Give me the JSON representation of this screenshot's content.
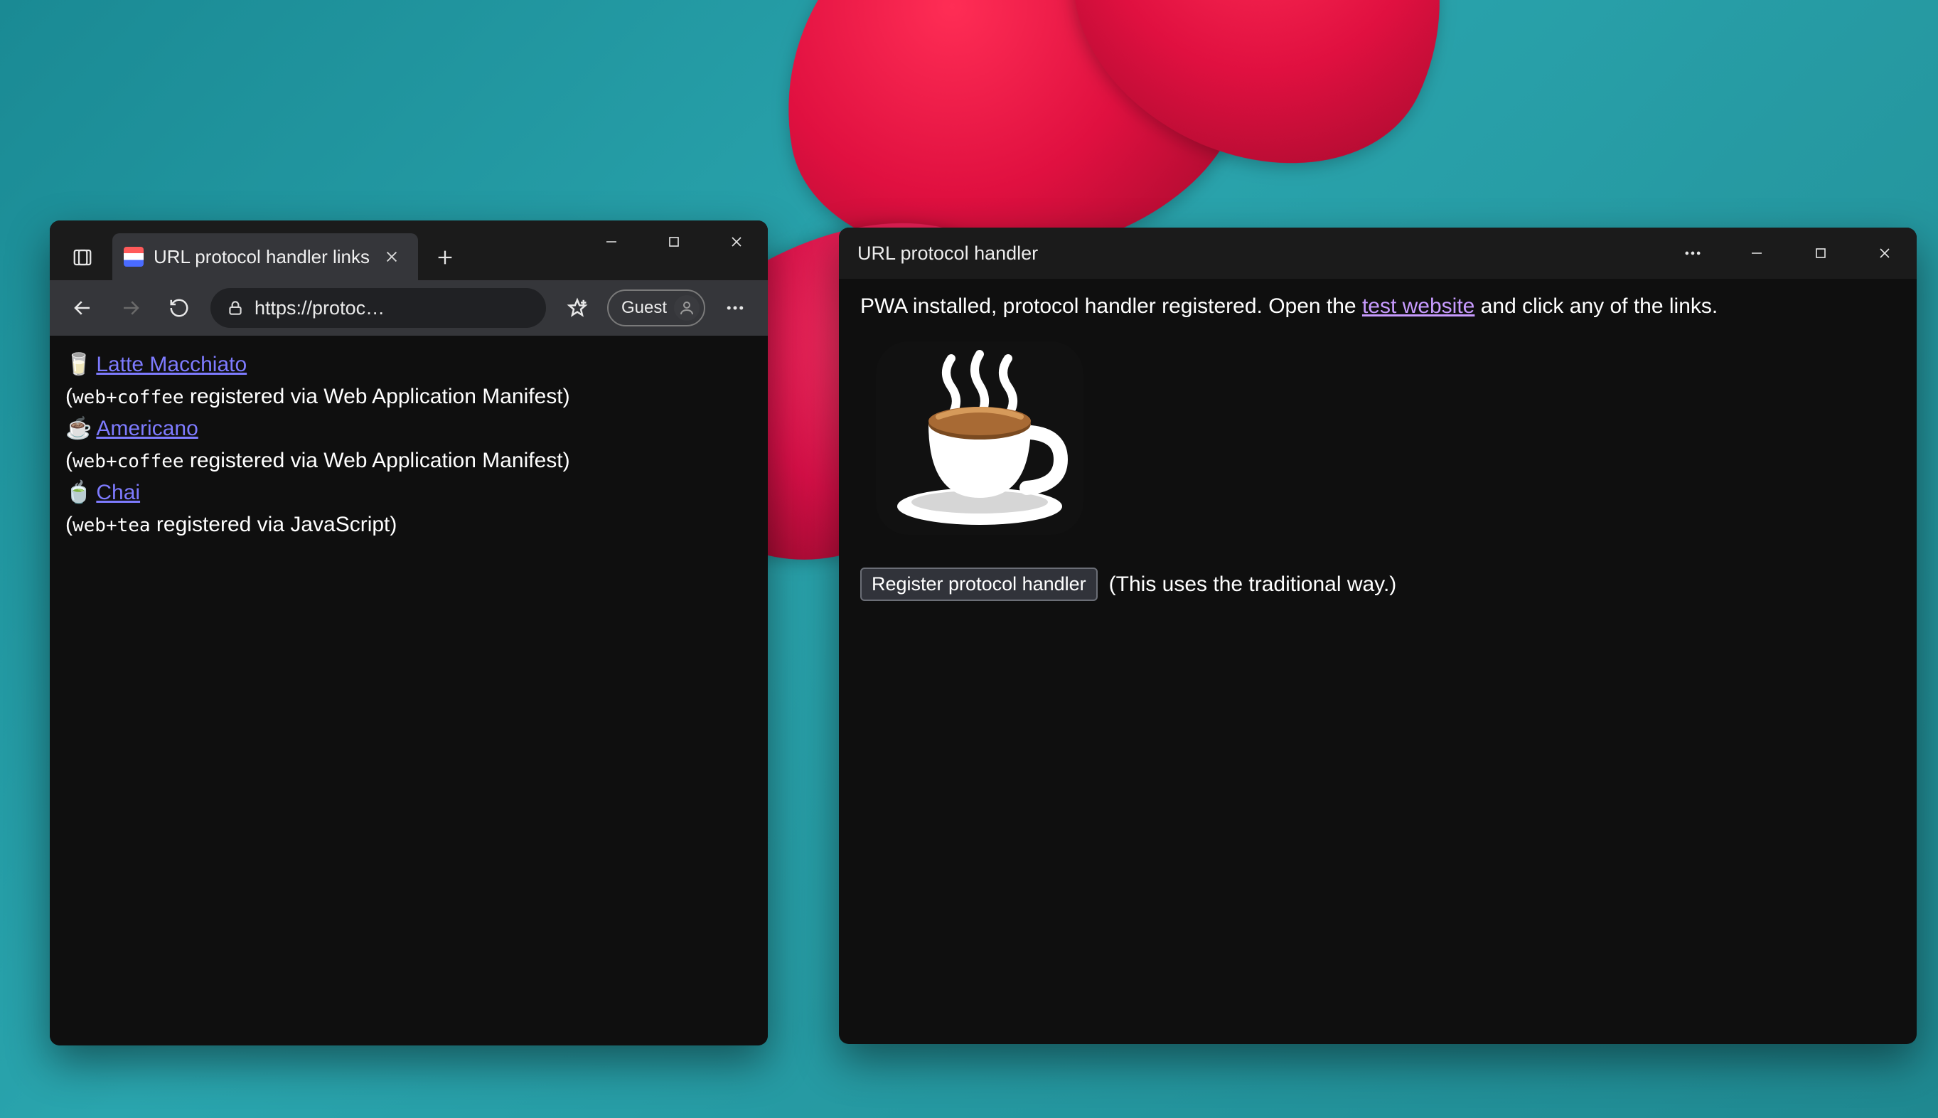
{
  "browser": {
    "tab": {
      "title": "URL protocol handler links"
    },
    "omnibox": {
      "url": "https://protoc…"
    },
    "profile": {
      "label": "Guest"
    },
    "page": {
      "items": [
        {
          "emoji": "🥛",
          "link": "Latte Macchiato",
          "note_pre": "(",
          "scheme": "web+coffee",
          "note_post": " registered via Web Application Manifest)"
        },
        {
          "emoji": "☕",
          "link": "Americano",
          "note_pre": "(",
          "scheme": "web+coffee",
          "note_post": " registered via Web Application Manifest)"
        },
        {
          "emoji": "🍵",
          "link": "Chai",
          "note_pre": "(",
          "scheme": "web+tea",
          "note_post": " registered via JavaScript)"
        }
      ]
    }
  },
  "pwa": {
    "title": "URL protocol handler",
    "body": {
      "msg_pre": "PWA installed, protocol handler registered. Open the ",
      "link": "test website",
      "msg_post": " and click any of the links."
    },
    "register_button": "Register protocol handler",
    "register_note": "(This uses the traditional way.)"
  }
}
